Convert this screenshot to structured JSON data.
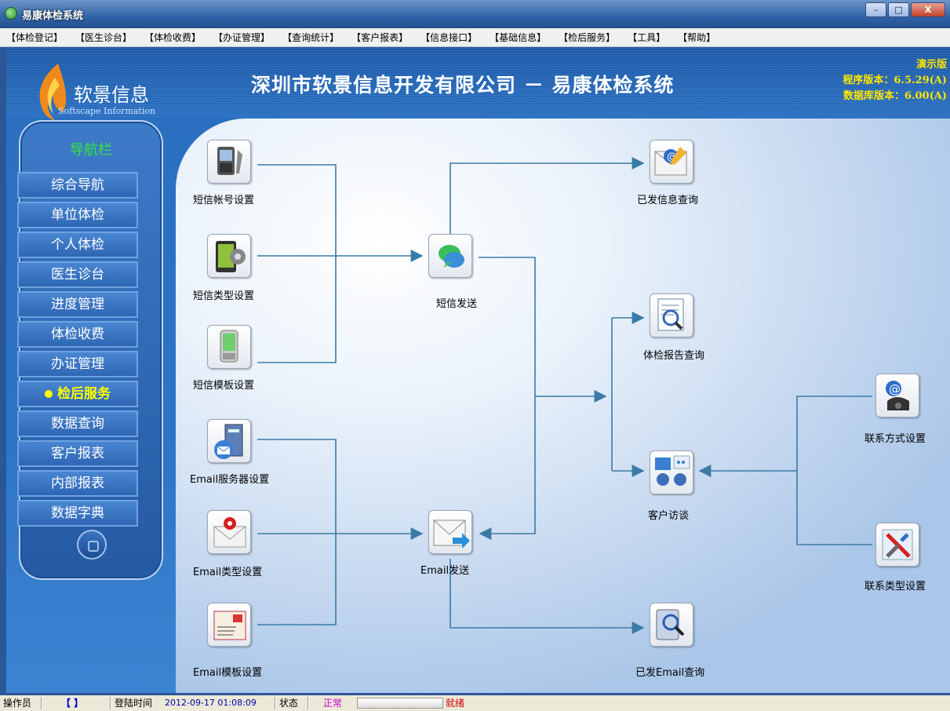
{
  "window": {
    "title": "易康体检系统",
    "buttons": {
      "minimize": "–",
      "maximize": "□",
      "close": "X"
    }
  },
  "menu": [
    "【体检登记】",
    "【医生诊台】",
    "【体检收费】",
    "【办证管理】",
    "【查询统计】",
    "【客户报表】",
    "【信息接口】",
    "【基础信息】",
    "【检后服务】",
    "【工具】",
    "【帮助】"
  ],
  "banner": {
    "logo_text": "软景信息",
    "logo_sub": "Softscape Information",
    "title": "深圳市软景信息开发有限公司 － 易康体检系统",
    "demo": "演示版",
    "program_version": "程序版本：6.5.29(A)",
    "db_version": "数据库版本：6.00(A)"
  },
  "nav": {
    "title": "导航栏",
    "items": [
      "综合导航",
      "单位体检",
      "个人体检",
      "医生诊台",
      "进度管理",
      "体检收费",
      "办证管理",
      "检后服务",
      "数据查询",
      "客户报表",
      "内部报表",
      "数据字典"
    ],
    "active_index": 7
  },
  "nodes": {
    "sms_account": {
      "label": "短信帐号设置",
      "icon": "sms-account-icon"
    },
    "sms_type": {
      "label": "短信类型设置",
      "icon": "sms-type-icon"
    },
    "sms_template": {
      "label": "短信模板设置",
      "icon": "sms-template-icon"
    },
    "email_server": {
      "label": "Email服务器设置",
      "icon": "email-server-icon"
    },
    "email_type": {
      "label": "Email类型设置",
      "icon": "email-type-icon"
    },
    "email_template": {
      "label": "Email模板设置",
      "icon": "email-template-icon"
    },
    "sms_send": {
      "label": "短信发送",
      "icon": "sms-send-icon"
    },
    "email_send": {
      "label": "Email发送",
      "icon": "email-send-icon"
    },
    "sent_sms_query": {
      "label": "已发信息查询",
      "icon": "sent-sms-query-icon"
    },
    "report_query": {
      "label": "体检报告查询",
      "icon": "report-query-icon"
    },
    "customer_interview": {
      "label": "客户访谈",
      "icon": "customer-interview-icon"
    },
    "sent_email_query": {
      "label": "已发Email查询",
      "icon": "sent-email-query-icon"
    },
    "contact_method": {
      "label": "联系方式设置",
      "icon": "contact-method-icon"
    },
    "contact_type": {
      "label": "联系类型设置",
      "icon": "contact-type-icon"
    }
  },
  "status": {
    "operator_label": "操作员",
    "operator_value": "【 】",
    "login_label": "登陆时间",
    "login_time": "2012-09-17 01:08:09",
    "state_label": "状态",
    "state_value": "正常",
    "ready": "就绪"
  },
  "colors": {
    "connector": "#3a7ba6",
    "nav_active": "#ffff00",
    "nav_title": "#37e43c",
    "version_text": "#ffe600",
    "state_text": "#cc00cc",
    "ready_text": "#cc0000"
  }
}
